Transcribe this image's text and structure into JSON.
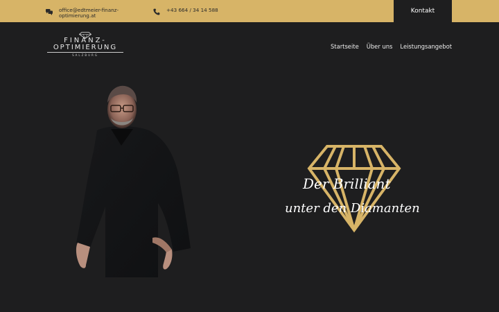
{
  "topbar": {
    "email": "office@edtmeier-finanz-optimierung.at",
    "phone": "+43 664 / 34 14 588",
    "kontakt_label": "Kontakt",
    "bg_color": "#d7b467"
  },
  "logo": {
    "line1": "FINANZ-",
    "line2": "OPTIMIERUNG",
    "line3": "SALZBURG"
  },
  "nav": {
    "items": [
      "Startseite",
      "Über uns",
      "Leistungsangebot"
    ]
  },
  "hero": {
    "tagline_line1": "Der Brilliant",
    "tagline_line2": "unter den Diamanten",
    "accent_color": "#d7b467"
  },
  "icons": [
    "chat-icon",
    "phone-icon",
    "diamond-icon"
  ]
}
